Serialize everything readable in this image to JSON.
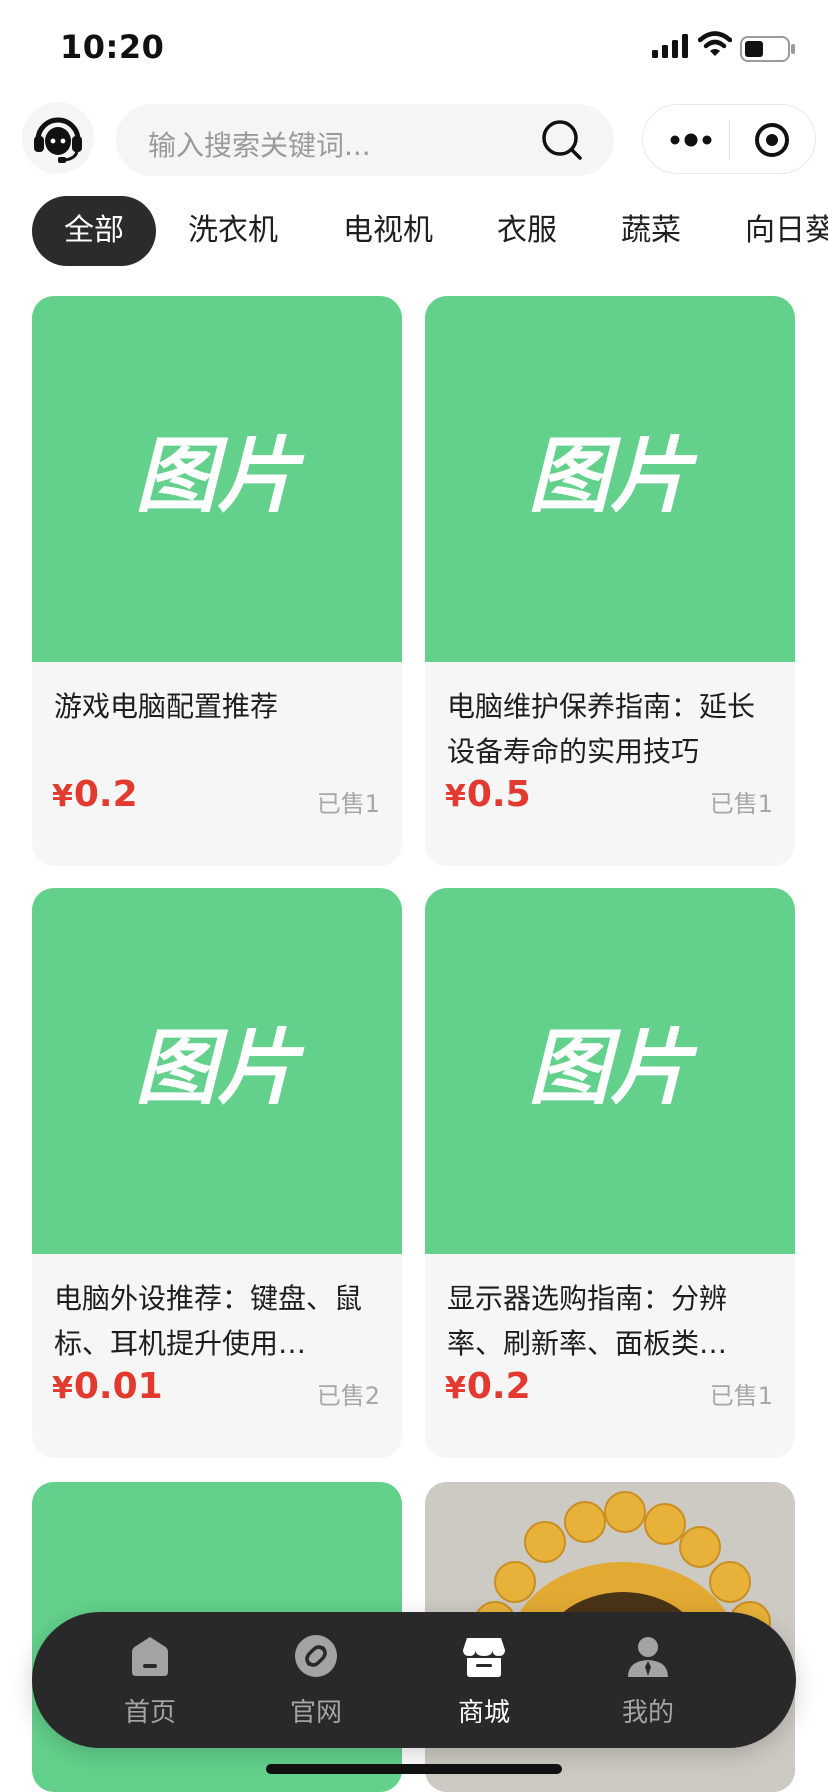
{
  "status_bar": {
    "time": "10:20"
  },
  "header": {
    "search_placeholder": "输入搜索关键词..."
  },
  "categories": [
    {
      "label": "全部",
      "active": true
    },
    {
      "label": "洗衣机"
    },
    {
      "label": "电视机"
    },
    {
      "label": "衣服"
    },
    {
      "label": "蔬菜"
    },
    {
      "label": "向日葵"
    }
  ],
  "placeholder_image_text": "图片",
  "products": [
    {
      "title": "游戏电脑配置推荐",
      "price_symbol": "¥",
      "price": "0.2",
      "sold": "已售1"
    },
    {
      "title": "电脑维护保养指南：延长设备寿命的实用技巧",
      "price_symbol": "¥",
      "price": "0.5",
      "sold": "已售1"
    },
    {
      "title": "电脑外设推荐：键盘、鼠标、耳机提升使用…",
      "price_symbol": "¥",
      "price": "0.01",
      "sold": "已售2"
    },
    {
      "title": "显示器选购指南：分辨率、刷新率、面板类…",
      "price_symbol": "¥",
      "price": "0.2",
      "sold": "已售1"
    }
  ],
  "bottom_nav": [
    {
      "label": "首页",
      "icon": "home-icon"
    },
    {
      "label": "官网",
      "icon": "website-icon"
    },
    {
      "label": "商城",
      "icon": "store-icon",
      "active": true
    },
    {
      "label": "我的",
      "icon": "profile-icon"
    }
  ],
  "colors": {
    "accent_price": "#e33a2f",
    "placeholder_green": "#63d18c",
    "nav_bg": "#292929",
    "tab_active_bg": "#2b2b2b"
  }
}
